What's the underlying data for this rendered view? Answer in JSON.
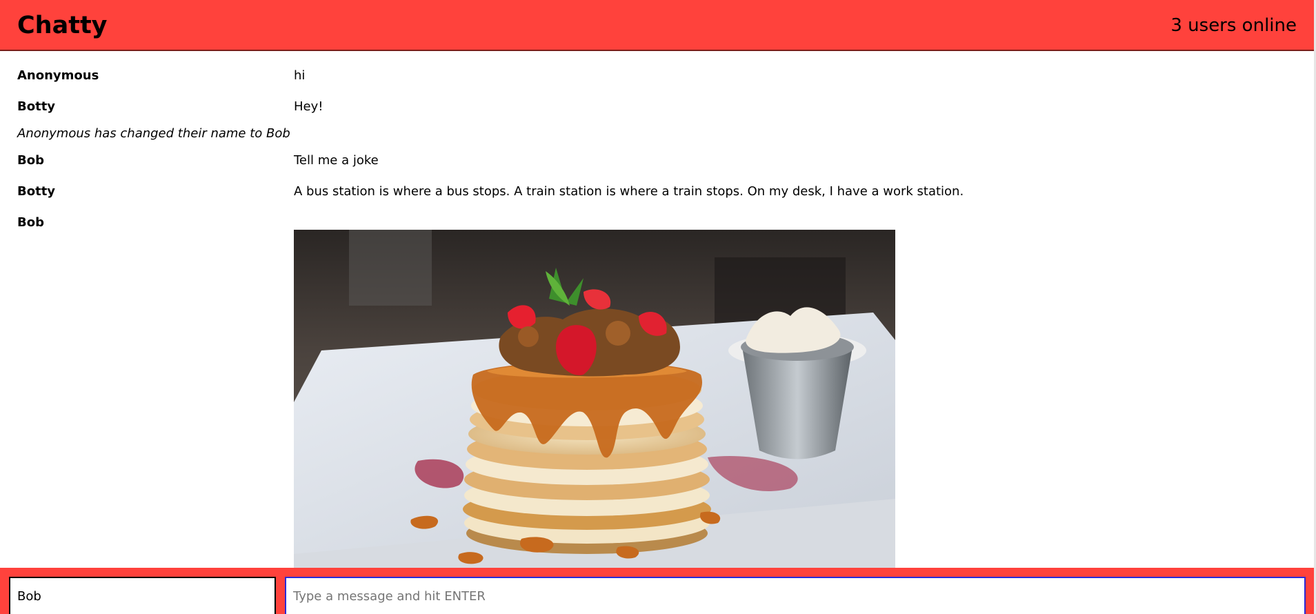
{
  "header": {
    "title": "Chatty",
    "users_online": "3 users online"
  },
  "messages": [
    {
      "type": "message",
      "username": "Anonymous",
      "content": "hi"
    },
    {
      "type": "message",
      "username": "Botty",
      "content": "Hey!"
    },
    {
      "type": "notification",
      "content": "Anonymous has changed their name to Bob"
    },
    {
      "type": "message",
      "username": "Bob",
      "content": "Tell me a joke"
    },
    {
      "type": "message",
      "username": "Botty",
      "content": "A bus station is where a bus stops. A train station is where a train stops. On my desk, I have a work station."
    },
    {
      "type": "image",
      "username": "Bob",
      "image_subject": "pancake-stack-photo"
    }
  ],
  "chatbar": {
    "username_value": "Bob",
    "message_placeholder": "Type a message and hit ENTER",
    "message_value": ""
  },
  "colors": {
    "accent": "#ff423c"
  }
}
